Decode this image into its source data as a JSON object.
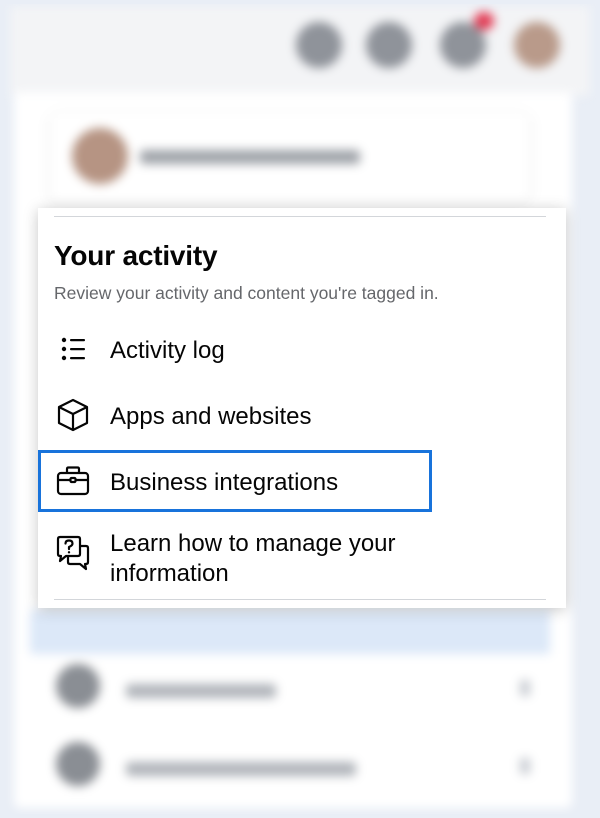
{
  "menu": {
    "section_title": "Your activity",
    "section_subtitle": "Review your activity and content you're tagged in.",
    "items": [
      {
        "label": "Activity log",
        "icon": "list-icon"
      },
      {
        "label": "Apps and websites",
        "icon": "cube-icon"
      },
      {
        "label": "Business integrations",
        "icon": "briefcase-icon",
        "highlighted": true
      },
      {
        "label": "Learn how to manage your information",
        "icon": "help-chat-icon"
      }
    ]
  },
  "colors": {
    "highlight_border": "#1873db",
    "title_text": "#050505",
    "subtitle_text": "#65676b"
  }
}
